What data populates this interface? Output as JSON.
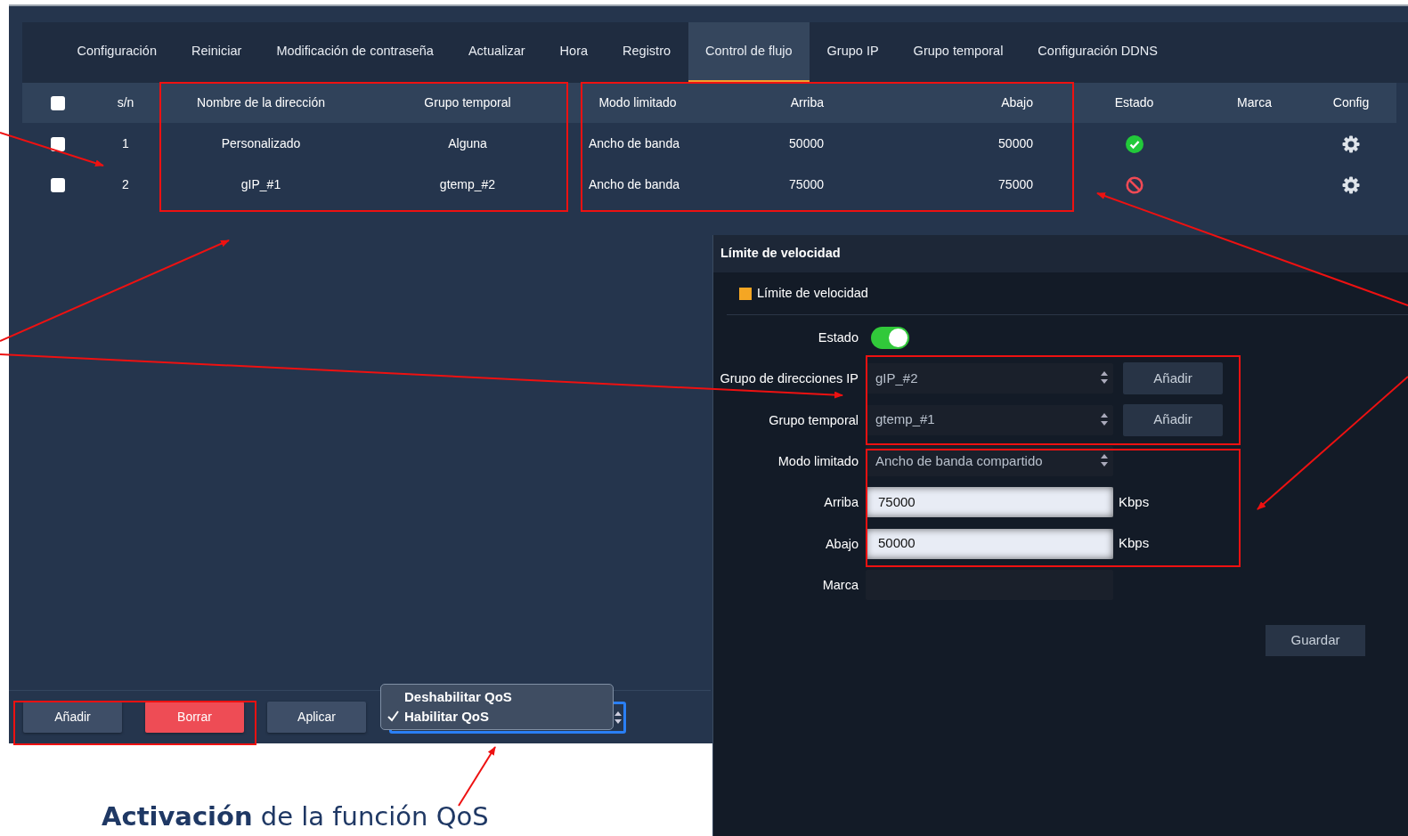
{
  "tabs": [
    {
      "label": "Configuración",
      "selected": false
    },
    {
      "label": "Reiniciar",
      "selected": false
    },
    {
      "label": "Modificación de contraseña",
      "selected": false
    },
    {
      "label": "Actualizar",
      "selected": false
    },
    {
      "label": "Hora",
      "selected": false
    },
    {
      "label": "Registro",
      "selected": false
    },
    {
      "label": "Control de flujo",
      "selected": true
    },
    {
      "label": "Grupo IP",
      "selected": false
    },
    {
      "label": "Grupo temporal",
      "selected": false
    },
    {
      "label": "Configuración DDNS",
      "selected": false
    }
  ],
  "table": {
    "header_checked": false,
    "columns": [
      "s/n",
      "Nombre de la dirección",
      "Grupo temporal",
      "Modo limitado",
      "Arriba",
      "Abajo",
      "Estado",
      "Marca",
      "Config"
    ],
    "rows": [
      {
        "checked": false,
        "sn": "1",
        "name": "Personalizado",
        "time_group": "Alguna",
        "mode": "Ancho de banda",
        "up": "50000",
        "down": "50000",
        "enabled": true
      },
      {
        "checked": false,
        "sn": "2",
        "name": "gIP_#1",
        "time_group": "gtemp_#2",
        "mode": "Ancho de banda",
        "up": "75000",
        "down": "75000",
        "enabled": false
      }
    ]
  },
  "toolbar": {
    "buttons": [
      {
        "label": "Añadir",
        "kind": "default"
      },
      {
        "label": "Borrar",
        "kind": "danger"
      },
      {
        "label": "Aplicar",
        "kind": "default"
      }
    ],
    "qos_menu": [
      {
        "label": "Deshabilitar QoS",
        "selected": false
      },
      {
        "label": "Habilitar QoS",
        "selected": true
      }
    ]
  },
  "dialog": {
    "title": "Límite de velocidad",
    "section": "Límite de velocidad",
    "fields": [
      {
        "kind": "toggle",
        "label": "Estado",
        "on": true
      },
      {
        "kind": "select",
        "label": "Grupo de direcciones IP",
        "value": "gIP_#2",
        "button": "Añadir"
      },
      {
        "kind": "select",
        "label": "Grupo temporal",
        "value": "gtemp_#1",
        "button": "Añadir"
      },
      {
        "kind": "select",
        "label": "Modo limitado",
        "value": "Ancho de banda compartido"
      },
      {
        "kind": "input",
        "label": "Arriba",
        "value": "75000",
        "unit": "Kbps"
      },
      {
        "kind": "input",
        "label": "Abajo",
        "value": "50000",
        "unit": "Kbps"
      },
      {
        "kind": "dark-input",
        "label": "Marca"
      }
    ],
    "save": "Guardar"
  },
  "caption": "**Activación** de la función QoS"
}
